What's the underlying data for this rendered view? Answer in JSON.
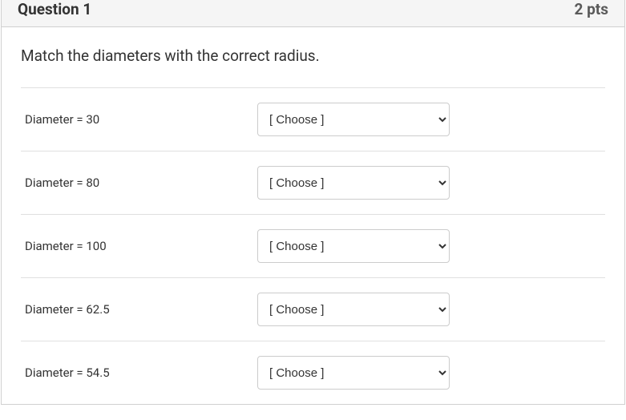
{
  "header": {
    "title": "Question 1",
    "points": "2 pts"
  },
  "prompt": "Match the diameters with the correct radius.",
  "choose_placeholder": "[ Choose ]",
  "rows": [
    {
      "label": "Diameter = 30"
    },
    {
      "label": "Diameter = 80"
    },
    {
      "label": "Diameter = 100"
    },
    {
      "label": "Diameter = 62.5"
    },
    {
      "label": "Diameter = 54.5"
    }
  ]
}
